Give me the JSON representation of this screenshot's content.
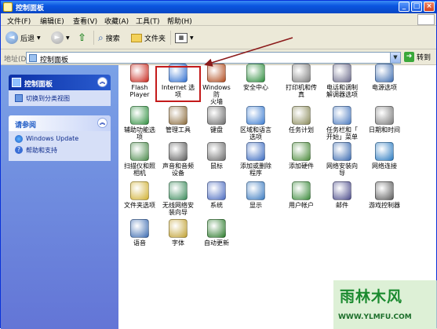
{
  "window": {
    "title": "控制面板",
    "min": "_",
    "max": "□",
    "close": "×"
  },
  "menu": [
    "文件(F)",
    "编辑(E)",
    "查看(V)",
    "收藏(A)",
    "工具(T)",
    "帮助(H)"
  ],
  "toolbar": {
    "back": "后退",
    "search": "搜索",
    "folders": "文件夹"
  },
  "address": {
    "label": "地址(D)",
    "value": "控制面板",
    "go": "转到"
  },
  "left_panel": {
    "cp_title": "控制面板",
    "switch_view": "切换到分类视图",
    "see_also_title": "请参阅",
    "see_also": [
      "Windows Update",
      "帮助和支持"
    ]
  },
  "items": [
    {
      "label": "Flash\nPlayer",
      "icon": "flash-player-icon"
    },
    {
      "label": "Internet 选\n项",
      "icon": "internet-options-icon"
    },
    {
      "label": "Windows 防\n火墙",
      "icon": "firewall-icon"
    },
    {
      "label": "安全中心",
      "icon": "security-center-icon"
    },
    {
      "label": "打印机和传\n真",
      "icon": "printers-icon"
    },
    {
      "label": "电话和调制\n解调器选项",
      "icon": "phone-modem-icon"
    },
    {
      "label": "电源选项",
      "icon": "power-options-icon"
    },
    {
      "label": "辅助功能选\n项",
      "icon": "accessibility-icon"
    },
    {
      "label": "管理工具",
      "icon": "admin-tools-icon"
    },
    {
      "label": "键盘",
      "icon": "keyboard-icon"
    },
    {
      "label": "区域和语言\n选项",
      "icon": "region-language-icon"
    },
    {
      "label": "任务计划",
      "icon": "scheduled-tasks-icon"
    },
    {
      "label": "任务栏和「\n开始」菜单",
      "icon": "taskbar-start-icon"
    },
    {
      "label": "日期和时间",
      "icon": "date-time-icon"
    },
    {
      "label": "扫描仪和照\n相机",
      "icon": "scanner-camera-icon"
    },
    {
      "label": "声音和音频\n设备",
      "icon": "sound-audio-icon"
    },
    {
      "label": "鼠标",
      "icon": "mouse-icon"
    },
    {
      "label": "添加或删除\n程序",
      "icon": "add-remove-programs-icon"
    },
    {
      "label": "添加硬件",
      "icon": "add-hardware-icon"
    },
    {
      "label": "网络安装向\n导",
      "icon": "network-setup-icon"
    },
    {
      "label": "网络连接",
      "icon": "network-connections-icon"
    },
    {
      "label": "文件夹选项",
      "icon": "folder-options-icon"
    },
    {
      "label": "无线网络安\n装向导",
      "icon": "wireless-setup-icon"
    },
    {
      "label": "系统",
      "icon": "system-icon"
    },
    {
      "label": "显示",
      "icon": "display-icon"
    },
    {
      "label": "用户帐户",
      "icon": "user-accounts-icon"
    },
    {
      "label": "邮件",
      "icon": "mail-icon"
    },
    {
      "label": "游戏控制器",
      "icon": "game-controllers-icon"
    },
    {
      "label": "语音",
      "icon": "speech-icon"
    },
    {
      "label": "字体",
      "icon": "fonts-icon"
    },
    {
      "label": "自动更新",
      "icon": "automatic-updates-icon"
    }
  ],
  "watermark": {
    "text": "雨林木风",
    "url": "WWW.YLMFU.COM"
  }
}
